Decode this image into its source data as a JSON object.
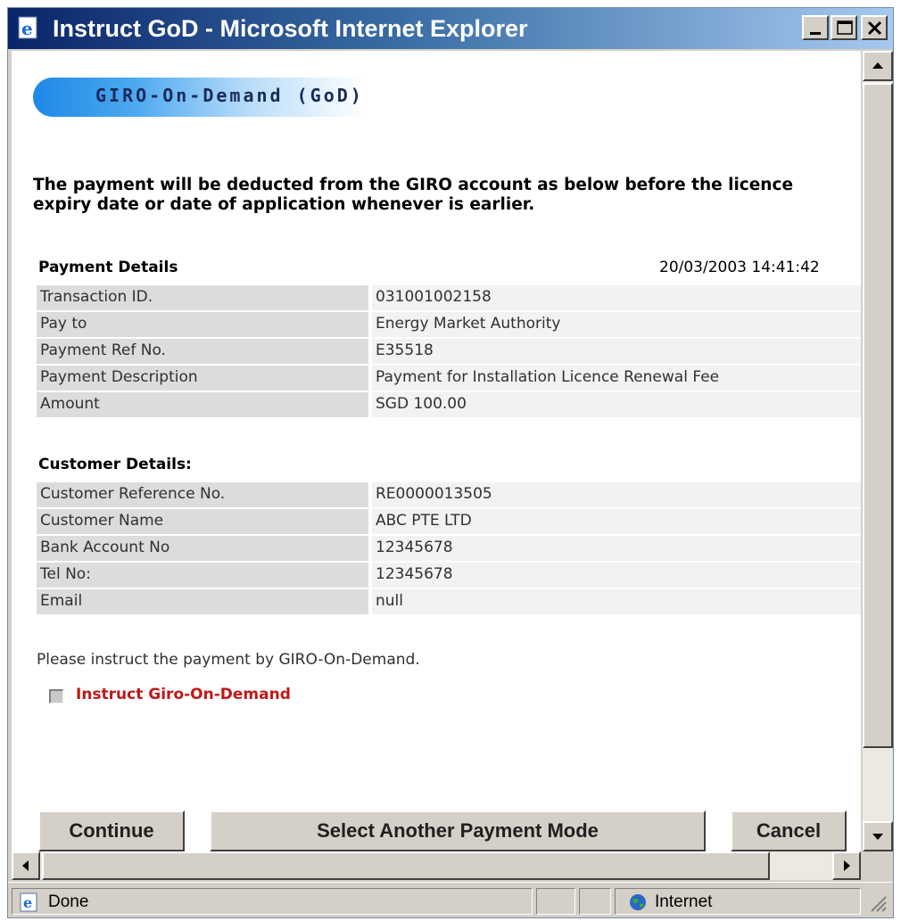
{
  "window": {
    "title": "Instruct GoD - Microsoft Internet Explorer",
    "title_icon": "ie-page-icon"
  },
  "banner": {
    "text": "GIRO-On-Demand (GoD)"
  },
  "notice": "The payment will be deducted from the GIRO account as below before the licence expiry date or date of application whenever is earlier.",
  "payment": {
    "title": "Payment Details",
    "timestamp": "20/03/2003 14:41:42",
    "rows": [
      {
        "label": "Transaction ID.",
        "value": "031001002158"
      },
      {
        "label": "Pay to",
        "value": "Energy Market Authority"
      },
      {
        "label": "Payment Ref No.",
        "value": "E35518"
      },
      {
        "label": "Payment Description",
        "value": "Payment for Installation Licence Renewal Fee"
      },
      {
        "label": "Amount",
        "value": "SGD 100.00"
      }
    ]
  },
  "customer": {
    "title": "Customer Details:",
    "rows": [
      {
        "label": "Customer Reference No.",
        "value": "RE0000013505"
      },
      {
        "label": "Customer Name",
        "value": "ABC PTE LTD"
      },
      {
        "label": "Bank Account No",
        "value": "12345678"
      },
      {
        "label": "Tel No:",
        "value": "12345678"
      },
      {
        "label": "Email",
        "value": "null"
      }
    ]
  },
  "instruction": {
    "text": "Please instruct the payment by GIRO-On-Demand.",
    "checkbox_label": "Instruct Giro-On-Demand",
    "checked": false
  },
  "buttons": {
    "continue": "Continue",
    "other_mode": "Select Another Payment Mode",
    "cancel": "Cancel"
  },
  "status": {
    "text": "Done",
    "zone": "Internet"
  },
  "colors": {
    "title_bar_start": "#0a246a",
    "title_bar_end": "#a6caf0",
    "checkbox_label": "#c01818",
    "banner": "#1e88e8"
  }
}
